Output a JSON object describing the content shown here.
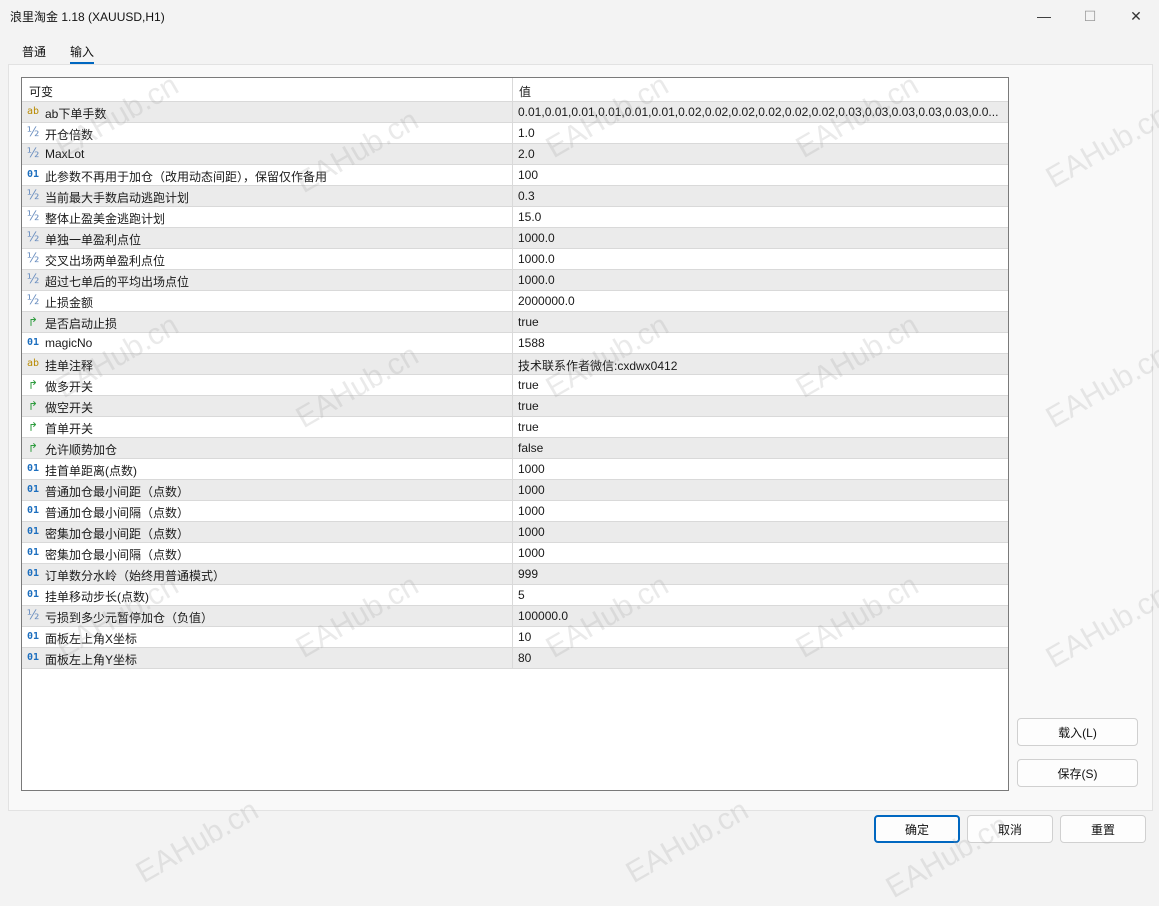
{
  "window": {
    "title": "浪里淘金 1.18 (XAUUSD,H1)",
    "minimize_glyph": "—",
    "maximize_glyph": "☐",
    "close_glyph": "✕"
  },
  "tabs": [
    {
      "label": "普通"
    },
    {
      "label": "输入"
    }
  ],
  "active_tab": "输入",
  "table": {
    "headers": {
      "name": "可变",
      "value": "值"
    },
    "rows": [
      {
        "icon": "ab",
        "name": "ab下单手数",
        "value": "0.01,0.01,0.01,0.01,0.01,0.01,0.02,0.02,0.02,0.02,0.02,0.02,0.03,0.03,0.03,0.03,0.03,0.0..."
      },
      {
        "icon": "½",
        "name": "开仓倍数",
        "value": "1.0"
      },
      {
        "icon": "½",
        "name": "MaxLot",
        "value": "2.0"
      },
      {
        "icon": "01",
        "name": "此参数不再用于加仓（改用动态间距），保留仅作备用",
        "value": "100"
      },
      {
        "icon": "½",
        "name": "当前最大手数启动逃跑计划",
        "value": "0.3"
      },
      {
        "icon": "½",
        "name": "整体止盈美金逃跑计划",
        "value": "15.0"
      },
      {
        "icon": "½",
        "name": "单独一单盈利点位",
        "value": "1000.0"
      },
      {
        "icon": "½",
        "name": "交叉出场两单盈利点位",
        "value": "1000.0"
      },
      {
        "icon": "½",
        "name": "超过七单后的平均出场点位",
        "value": "1000.0"
      },
      {
        "icon": "½",
        "name": "止损金额",
        "value": "2000000.0"
      },
      {
        "icon": "bool",
        "name": "是否启动止损",
        "value": "true"
      },
      {
        "icon": "01",
        "name": "magicNo",
        "value": "1588"
      },
      {
        "icon": "ab",
        "name": "挂单注释",
        "value": "技术联系作者微信:cxdwx0412"
      },
      {
        "icon": "bool",
        "name": "做多开关",
        "value": "true"
      },
      {
        "icon": "bool",
        "name": "做空开关",
        "value": "true"
      },
      {
        "icon": "bool",
        "name": "首单开关",
        "value": "true"
      },
      {
        "icon": "bool",
        "name": "允许顺势加仓",
        "value": "false"
      },
      {
        "icon": "01",
        "name": "挂首单距离(点数)",
        "value": "1000"
      },
      {
        "icon": "01",
        "name": "普通加仓最小间距（点数）",
        "value": "1000"
      },
      {
        "icon": "01",
        "name": "普通加仓最小间隔（点数）",
        "value": "1000"
      },
      {
        "icon": "01",
        "name": "密集加仓最小间距（点数）",
        "value": "1000"
      },
      {
        "icon": "01",
        "name": "密集加仓最小间隔（点数）",
        "value": "1000"
      },
      {
        "icon": "01",
        "name": "订单数分水岭（始终用普通模式）",
        "value": "999"
      },
      {
        "icon": "01",
        "name": "挂单移动步长(点数)",
        "value": "5"
      },
      {
        "icon": "½",
        "name": "亏损到多少元暂停加仓（负值）",
        "value": "100000.0"
      },
      {
        "icon": "01",
        "name": "面板左上角X坐标",
        "value": "10"
      },
      {
        "icon": "01",
        "name": "面板左上角Y坐标",
        "value": "80"
      }
    ]
  },
  "buttons": {
    "load": "载入(L)",
    "save": "保存(S)",
    "ok": "确定",
    "cancel": "取消",
    "reset": "重置"
  },
  "watermark": "EAHub.cn",
  "colors": {
    "accent": "#0067c0",
    "alt_row": "#ebebeb"
  }
}
